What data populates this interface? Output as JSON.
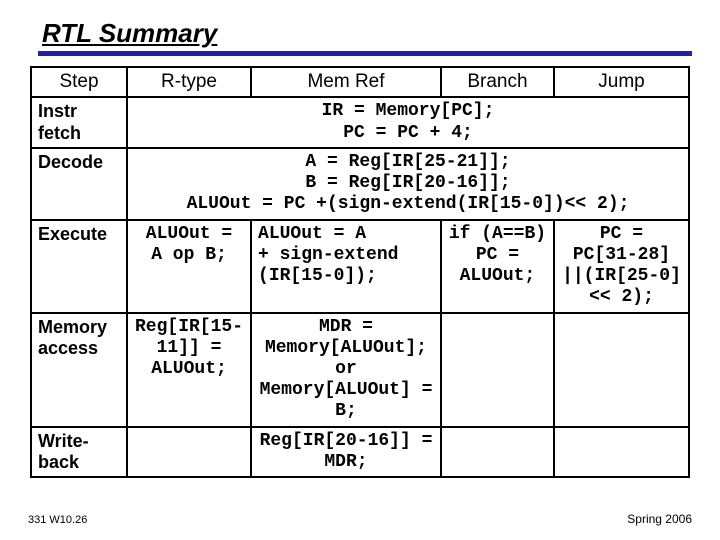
{
  "title": "RTL Summary",
  "headers": {
    "step": "Step",
    "rtype": "R-type",
    "memref": "Mem Ref",
    "branch": "Branch",
    "jump": "Jump"
  },
  "rows": {
    "fetch": {
      "label": "Instr\nfetch",
      "span": "IR = Memory[PC];\nPC = PC + 4;"
    },
    "decode": {
      "label": "Decode",
      "span": "A = Reg[IR[25-21]];\nB = Reg[IR[20-16]];\nALUOut = PC +(sign-extend(IR[15-0])<< 2);"
    },
    "execute": {
      "label": "Execute",
      "rtype": "ALUOut =\n A op B;",
      "memref": "ALUOut =        A\n + sign-extend\n (IR[15-0]);",
      "branch": "if (A==B)\n PC =\n ALUOut;",
      "jump": " PC =\nPC[31-28]\n||(IR[25-0]\n << 2);"
    },
    "memory": {
      "label": "Memory\naccess",
      "rtype": "Reg[IR[15-\n11]] =\nALUOut;",
      "memref": "MDR =\nMemory[ALUOut];\nor\nMemory[ALUOut] =\nB;",
      "branch": "",
      "jump": ""
    },
    "writeback": {
      "label": "Write-\nback",
      "rtype": "",
      "memref": "Reg[IR[20-16]] =\nMDR;",
      "branch": "",
      "jump": ""
    }
  },
  "footer": {
    "left": "331 W10.26",
    "right": "Spring 2006"
  }
}
